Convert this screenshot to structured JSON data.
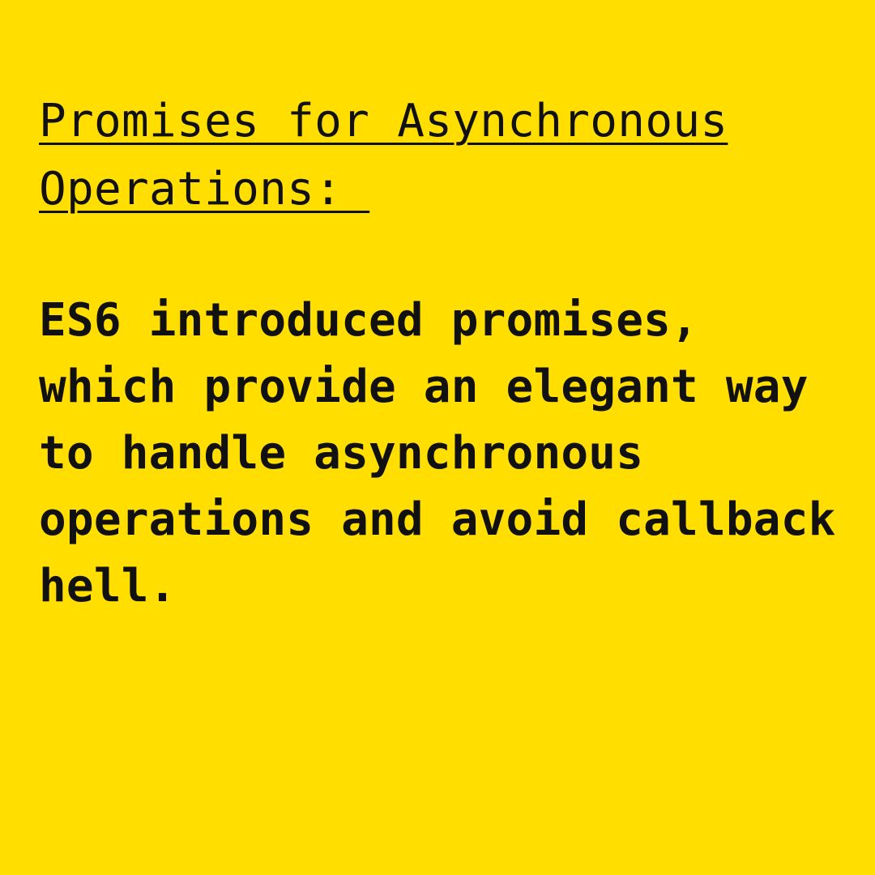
{
  "slide": {
    "heading": "Promises for Asynchronous\nOperations: ",
    "body": "ES6 introduced promises,\nwhich provide an elegant way\nto handle asynchronous\noperations and avoid callback\nhell.",
    "background_color": "#FFDE00",
    "text_color": "#111111"
  }
}
